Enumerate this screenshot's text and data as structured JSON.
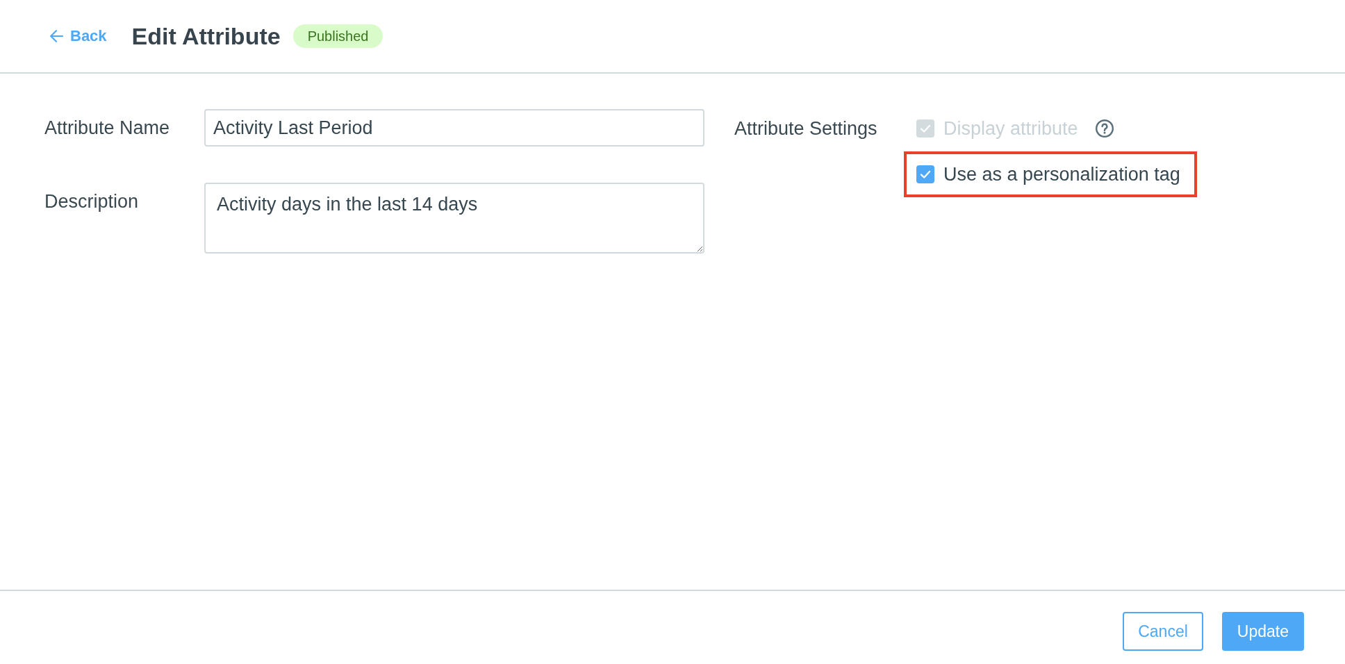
{
  "header": {
    "back": {
      "label": "Back"
    },
    "title": "Edit Attribute",
    "status_badge": "Published"
  },
  "form": {
    "fields": [
      {
        "label": "Attribute Name",
        "kind": "input",
        "value": "Activity Last Period"
      },
      {
        "label": "Description",
        "kind": "textarea",
        "value": "Activity days in the last 14 days"
      }
    ]
  },
  "settings": {
    "label": "Attribute Settings",
    "options": [
      {
        "label": "Display attribute",
        "checked": true,
        "disabled": true,
        "help": true,
        "highlighted": false
      },
      {
        "label": "Use as a personalization tag",
        "checked": true,
        "disabled": false,
        "help": false,
        "highlighted": true
      }
    ]
  },
  "footer": {
    "buttons": [
      {
        "label": "Cancel",
        "kind": "secondary"
      },
      {
        "label": "Update",
        "kind": "primary"
      }
    ]
  }
}
